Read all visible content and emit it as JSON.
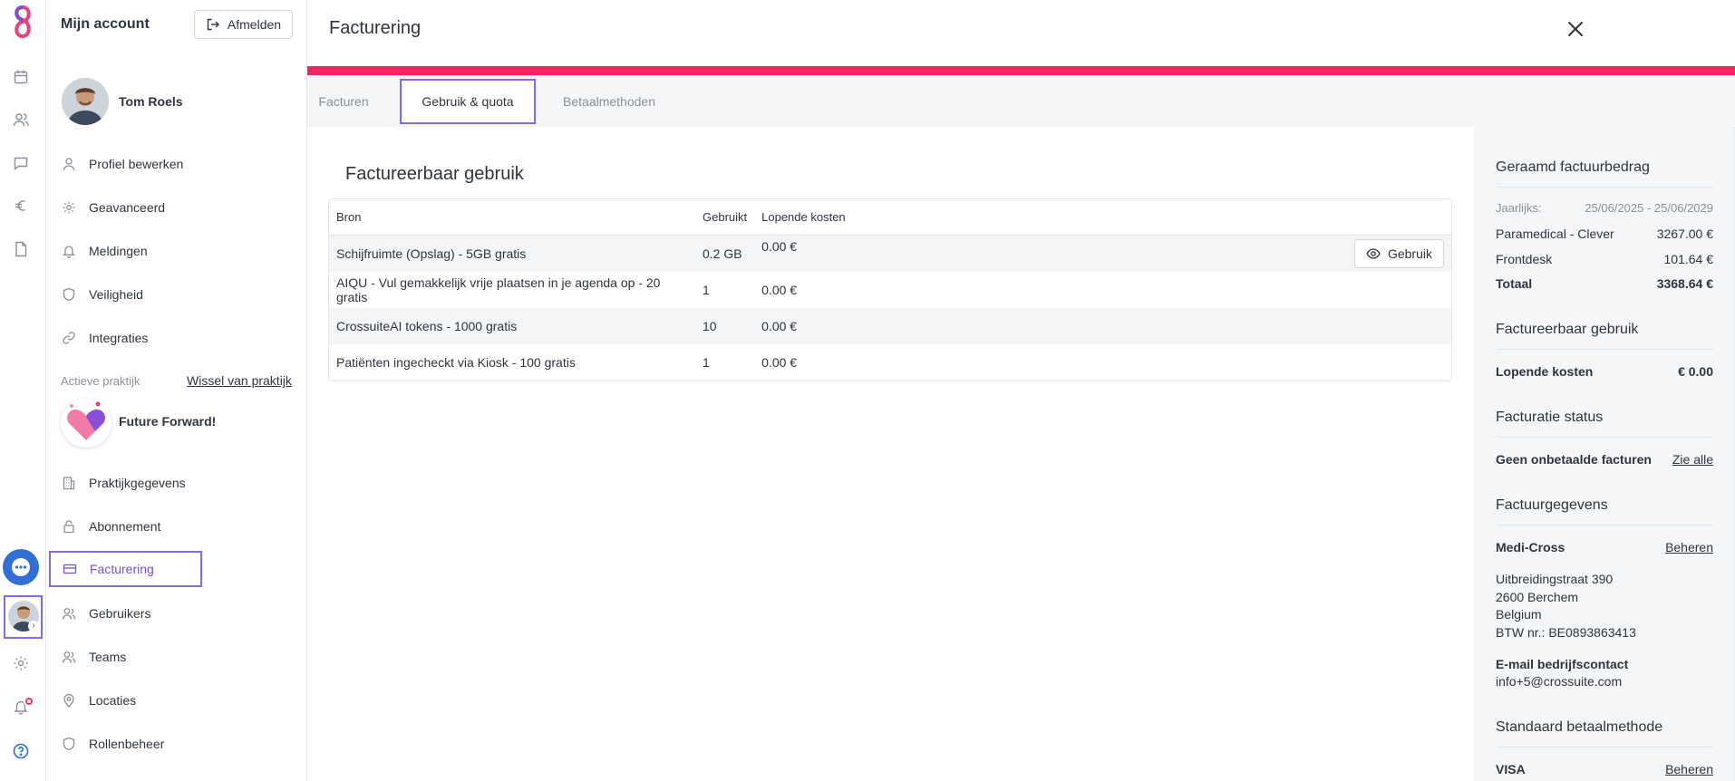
{
  "rail": {
    "icons": [
      "calendar-icon",
      "people-icon",
      "chat-icon",
      "euro-icon",
      "document-icon",
      "settings-icon",
      "bell-icon",
      "help-icon"
    ]
  },
  "account": {
    "title": "Mijn account",
    "logout_label": "Afmelden",
    "user_name": "Tom Roels",
    "menu": [
      {
        "label": "Profiel bewerken",
        "icon": "user-icon"
      },
      {
        "label": "Geavanceerd",
        "icon": "gear-icon"
      },
      {
        "label": "Meldingen",
        "icon": "bell-icon"
      },
      {
        "label": "Veiligheid",
        "icon": "shield-icon"
      },
      {
        "label": "Integraties",
        "icon": "link-icon"
      }
    ],
    "practice_section_label": "Actieve praktijk",
    "switch_practice_label": "Wissel van praktijk",
    "practice_name": "Future Forward!",
    "practice_menu": [
      {
        "label": "Praktijkgegevens",
        "icon": "building-icon"
      },
      {
        "label": "Abonnement",
        "icon": "lock-icon"
      },
      {
        "label": "Facturering",
        "icon": "credit-card-icon",
        "active": true
      },
      {
        "label": "Gebruikers",
        "icon": "users-icon"
      },
      {
        "label": "Teams",
        "icon": "team-icon"
      },
      {
        "label": "Locaties",
        "icon": "location-icon"
      },
      {
        "label": "Rollenbeheer",
        "icon": "shield-icon"
      }
    ]
  },
  "main": {
    "title": "Facturering",
    "tabs": [
      {
        "label": "Facturen",
        "active": false
      },
      {
        "label": "Gebruik & quota",
        "active": true
      },
      {
        "label": "Betaalmethoden",
        "active": false
      }
    ],
    "section_title": "Factureerbaar gebruik",
    "table": {
      "headers": [
        "Bron",
        "Gebruikt",
        "Lopende kosten"
      ],
      "rows": [
        {
          "source": "Schijfruimte (Opslag) - 5GB gratis",
          "used": "0.2 GB",
          "cost": "0.00 €",
          "action": "Gebruik"
        },
        {
          "source": "AIQU - Vul gemakkelijk vrije plaatsen in je agenda op - 20 gratis",
          "used": "1",
          "cost": "0.00 €"
        },
        {
          "source": "CrossuiteAI tokens - 1000 gratis",
          "used": "10",
          "cost": "0.00 €"
        },
        {
          "source": "Patiënten ingecheckt via Kiosk - 100 gratis",
          "used": "1",
          "cost": "0.00 €"
        }
      ]
    }
  },
  "summary": {
    "estimate_title": "Geraamd factuurbedrag",
    "period_label": "Jaarlijks:",
    "period_value": "25/06/2025 - 25/06/2029",
    "lines": [
      {
        "label": "Paramedical - Clever",
        "value": "3267.00 €"
      },
      {
        "label": "Frontdesk",
        "value": "101.64 €"
      }
    ],
    "total_label": "Totaal",
    "total_value": "3368.64 €",
    "usage_title": "Factureerbaar gebruik",
    "running_label": "Lopende kosten",
    "running_value": "€ 0.00",
    "status_title": "Facturatie status",
    "status_text": "Geen onbetaalde facturen",
    "status_link": "Zie alle",
    "details_title": "Factuurgegevens",
    "company": "Medi-Cross",
    "manage_label": "Beheren",
    "address": [
      "Uitbreidingstraat 390",
      "2600 Berchem",
      "Belgium",
      "BTW nr.: BE0893863413"
    ],
    "email_label": "E-mail bedrijfscontact",
    "email": "info+5@crossuite.com",
    "payment_title": "Standaard betaalmethode",
    "payment_method": "VISA",
    "payment_manage_label": "Beheren"
  }
}
